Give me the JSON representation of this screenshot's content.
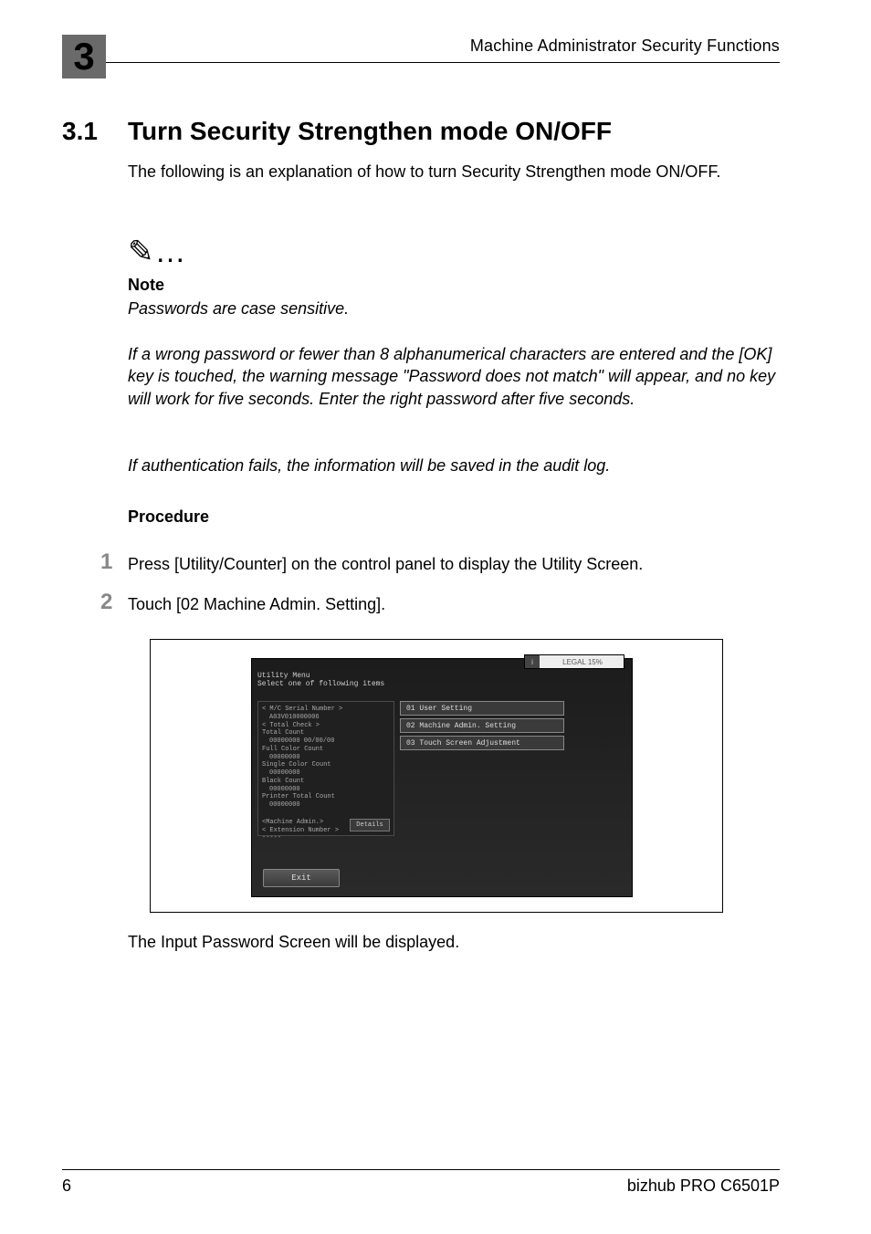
{
  "chapter_number": "3",
  "running_head": "Machine Administrator Security Functions",
  "section": {
    "number": "3.1",
    "title": "Turn Security Strengthen mode ON/OFF"
  },
  "intro_text": "The following is an explanation of how to turn Security Strengthen mode ON/OFF.",
  "note": {
    "icon": "✎…",
    "label": "Note",
    "line1": "Passwords are case sensitive.",
    "para2": "If a wrong password or fewer than 8 alphanumerical characters are entered and the [OK] key is touched, the warning message \"Password does not match\" will appear, and no key will work for five seconds. Enter the right password after five seconds.",
    "para3": "If authentication fails, the information will be saved in the audit log."
  },
  "procedure": {
    "label": "Procedure",
    "steps": [
      {
        "num": "1",
        "text": "Press [Utility/Counter] on the control panel to display the Utility Screen."
      },
      {
        "num": "2",
        "text": "Touch [02 Machine Admin. Setting]."
      }
    ]
  },
  "screenshot": {
    "memory_label": "LEGAL 15%",
    "memory_icon": "i",
    "header_line1": "Utility Menu",
    "header_line2": "Select one of following items",
    "left_panel": {
      "l1": "< M/C Serial Number >",
      "l2": "A03V010000006",
      "l3": "< Total Check >",
      "l4": "Total Count",
      "l5": "00000000        00/00/00",
      "l6": "Full Color Count",
      "l7": "00000000",
      "l8": "Single Color Count",
      "l9": "00000000",
      "l10": "Black Count",
      "l11": "00000000",
      "l12": "Printer Total Count",
      "l13": "00000000",
      "l14": "<Machine Admin.>",
      "l15": "< Extension Number >",
      "l16": "-----"
    },
    "details_btn": "Details",
    "right_buttons": [
      "01 User Setting",
      "02 Machine Admin. Setting",
      "03 Touch Screen Adjustment"
    ],
    "exit_btn": "Exit"
  },
  "after_shot": "The Input Password Screen will be displayed.",
  "footer": {
    "page_number": "6",
    "product": "bizhub PRO C6501P"
  }
}
